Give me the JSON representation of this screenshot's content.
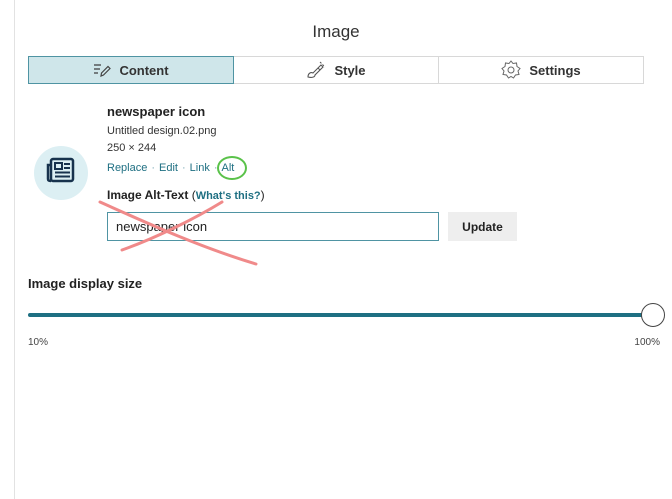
{
  "panel": {
    "title": "Image"
  },
  "tabs": [
    {
      "label": "Content",
      "icon": "edit-lines-icon",
      "active": true
    },
    {
      "label": "Style",
      "icon": "brush-icon",
      "active": false
    },
    {
      "label": "Settings",
      "icon": "gear-icon",
      "active": false
    }
  ],
  "image": {
    "name": "newspaper icon",
    "filename": "Untitled design.02.png",
    "dimensions": "250 × 244",
    "thumbnail_icon": "newspaper-icon",
    "actions": [
      "Replace",
      "Edit",
      "Link",
      "Alt"
    ]
  },
  "alt_text": {
    "label": "Image Alt-Text",
    "paren_open": "(",
    "help_link": "What's this?",
    "paren_close": ")",
    "value": "newspaper icon",
    "update_label": "Update"
  },
  "display_size": {
    "label": "Image display size",
    "min_label": "10%",
    "max_label": "100%",
    "value_percent": 100
  },
  "colors": {
    "accent": "#1e6f82",
    "active_tab_bg": "#cfe6ea",
    "annotation_circle": "#5ac24a",
    "annotation_cross": "#f08a8a"
  }
}
